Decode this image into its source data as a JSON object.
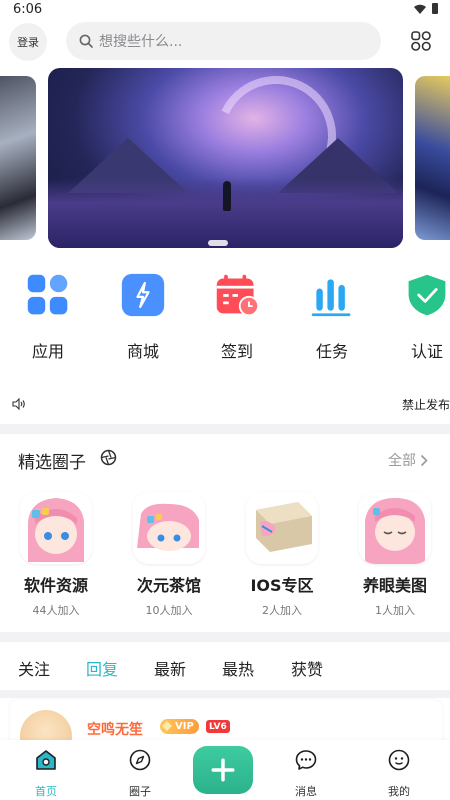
{
  "status_bar": {
    "time": "6:06"
  },
  "header": {
    "login_label": "登录",
    "search_placeholder": "想搜些什么..."
  },
  "quick_menu": [
    {
      "label": "应用",
      "icon": "apps-grid-icon",
      "color": "#3e8bff"
    },
    {
      "label": "商城",
      "icon": "lightning-icon",
      "color": "#4b90ff"
    },
    {
      "label": "签到",
      "icon": "calendar-clock-icon",
      "color": "#ff4d57"
    },
    {
      "label": "任务",
      "icon": "bar-chart-icon",
      "color": "#2aa9f2"
    },
    {
      "label": "认证",
      "icon": "shield-check-icon",
      "color": "#28c58a"
    }
  ],
  "notice": {
    "text": "禁止发布"
  },
  "circles": {
    "title": "精选圈子",
    "all_label": "全部",
    "items": [
      {
        "name": "软件资源",
        "members": "44人加入"
      },
      {
        "name": "次元茶馆",
        "members": "10人加入"
      },
      {
        "name": "IOS专区",
        "members": "2人加入"
      },
      {
        "name": "养眼美图",
        "members": "1人加入"
      }
    ]
  },
  "feed_tabs": [
    "关注",
    "回复",
    "最新",
    "最热",
    "获赞"
  ],
  "feed_active_tab": "回复",
  "post": {
    "author": "空鸣无笙",
    "vip_label": "VIP",
    "level_label": "LV6"
  },
  "bottom_nav": [
    {
      "label": "首页",
      "icon": "home-icon",
      "active": true
    },
    {
      "label": "圈子",
      "icon": "compass-icon",
      "active": false
    },
    {
      "label": "消息",
      "icon": "chat-icon",
      "active": false
    },
    {
      "label": "我的",
      "icon": "profile-icon",
      "active": false
    }
  ],
  "colors": {
    "accent": "#2bb7c8",
    "add_button": "#33be95",
    "author_name": "#ff6a3d"
  }
}
